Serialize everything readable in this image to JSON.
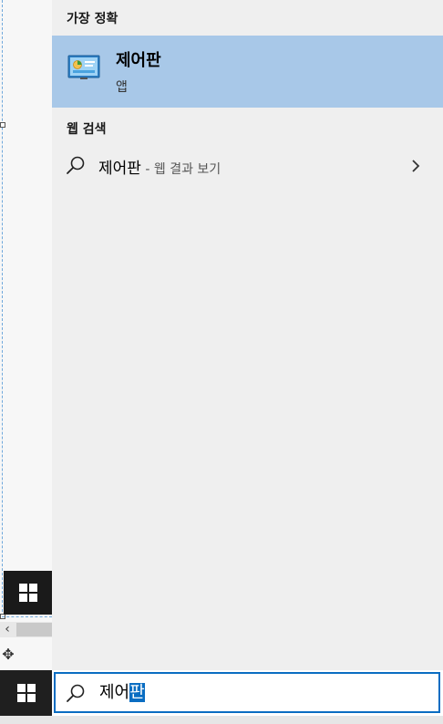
{
  "start_menu": {
    "best_match_header": "가장 정확",
    "best_match": {
      "title": "제어판",
      "subtitle": "앱",
      "icon": "control-panel-icon"
    },
    "web_search_header": "웹 검색",
    "web_result": {
      "query": "제어판",
      "suffix": " - 웹 결과 보기",
      "icon": "search-icon",
      "chevron_icon": "chevron-right-icon"
    }
  },
  "search_box": {
    "typed_text": "제어",
    "selected_text": "판",
    "icon": "search-icon"
  },
  "colors": {
    "panel_bg": "#efefef",
    "selection_bg": "#a8c8e8",
    "accent": "#0a6dc2",
    "taskbar": "#1f1f1f"
  }
}
